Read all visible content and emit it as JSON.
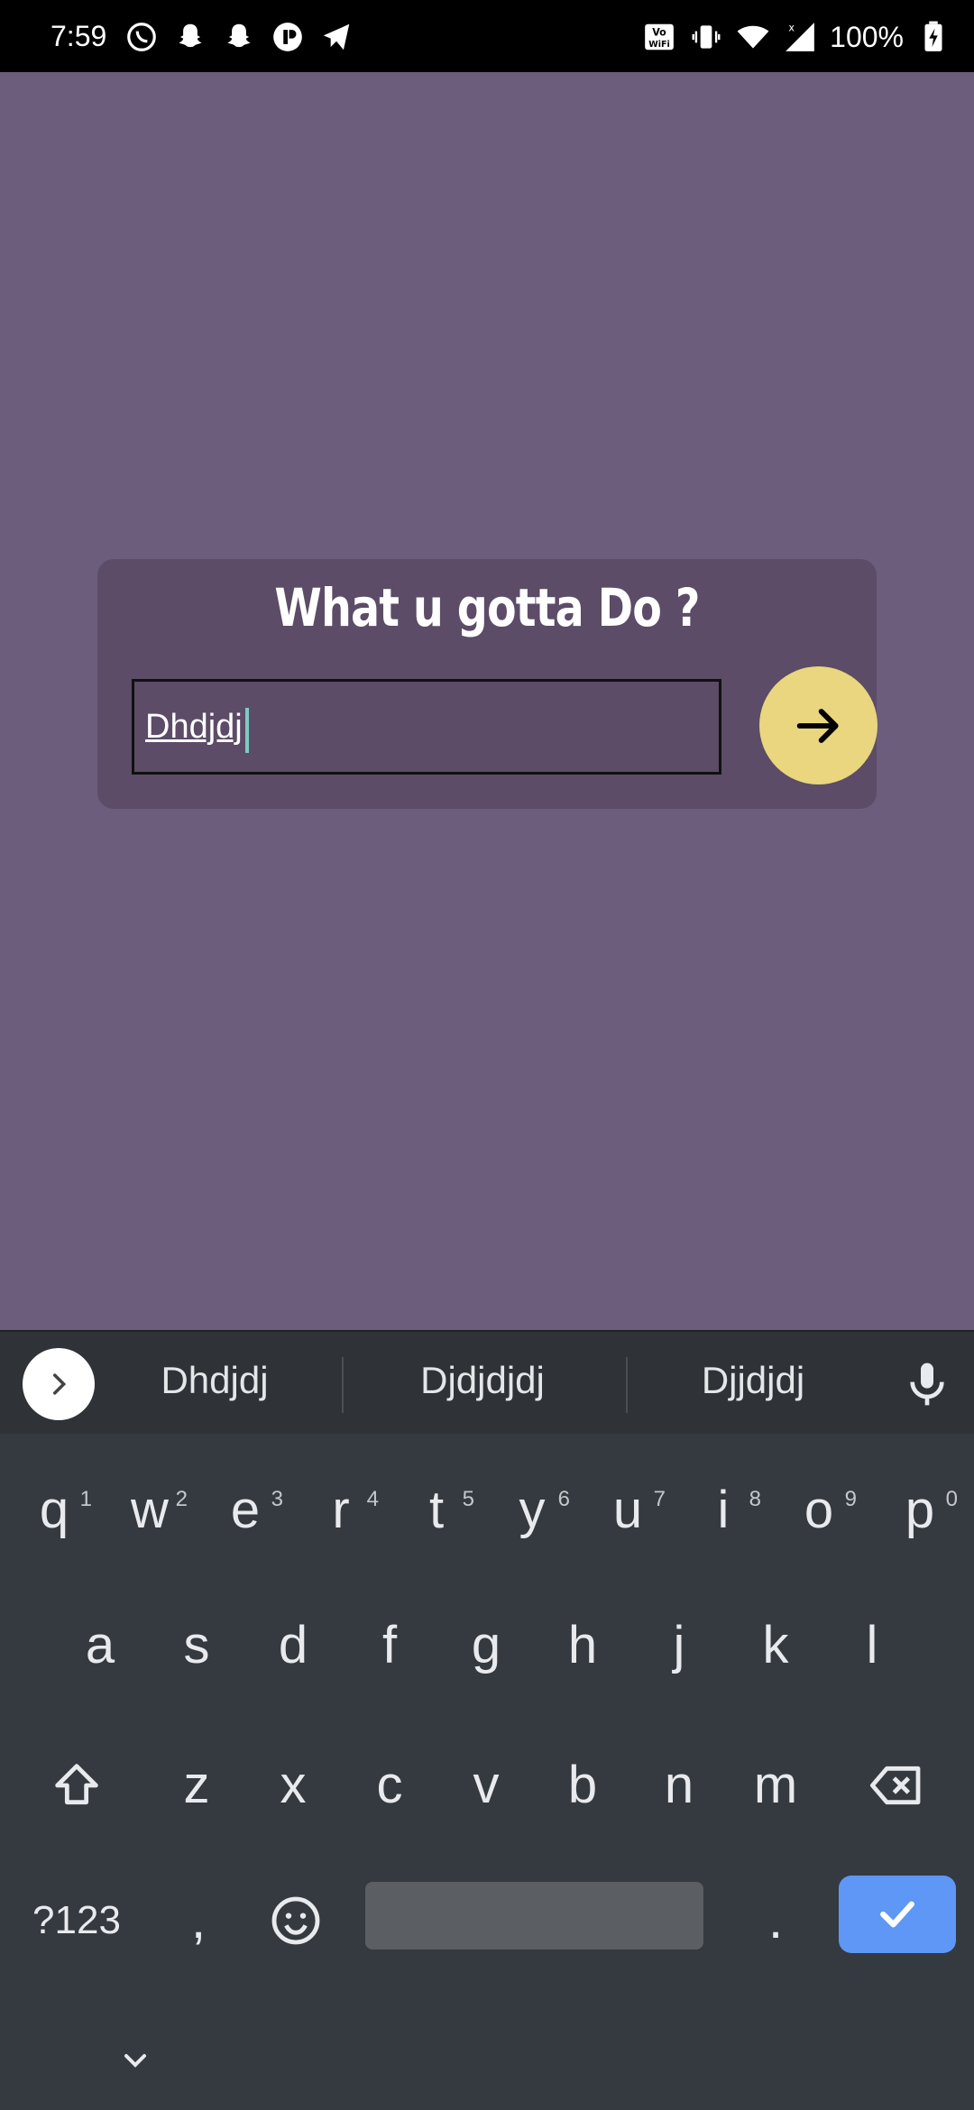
{
  "status": {
    "time": "7:59",
    "battery": "100%",
    "left_icons": [
      "whatsapp-icon",
      "snapchat-icon",
      "snapchat-icon",
      "app-icon",
      "telegram-icon"
    ],
    "right_icons": [
      "vowifi-icon",
      "vibrate-icon",
      "wifi-icon",
      "signal-icon",
      "battery-charging-icon"
    ]
  },
  "app": {
    "title": "What u gotta Do ?",
    "input_value": "Dhdjdj",
    "submit_icon": "arrow-right-icon",
    "colors": {
      "background": "#6b5d7b",
      "card": "#5c4c67",
      "button": "#e9d67e"
    }
  },
  "keyboard": {
    "suggestions": [
      "Dhdjdj",
      "Djdjdjdj",
      "Djjdjdj"
    ],
    "row1": [
      {
        "key": "q",
        "hint": "1"
      },
      {
        "key": "w",
        "hint": "2"
      },
      {
        "key": "e",
        "hint": "3"
      },
      {
        "key": "r",
        "hint": "4"
      },
      {
        "key": "t",
        "hint": "5"
      },
      {
        "key": "y",
        "hint": "6"
      },
      {
        "key": "u",
        "hint": "7"
      },
      {
        "key": "i",
        "hint": "8"
      },
      {
        "key": "o",
        "hint": "9"
      },
      {
        "key": "p",
        "hint": "0"
      }
    ],
    "row2": [
      "a",
      "s",
      "d",
      "f",
      "g",
      "h",
      "j",
      "k",
      "l"
    ],
    "row3": [
      "z",
      "x",
      "c",
      "v",
      "b",
      "n",
      "m"
    ],
    "symbols_label": "?123",
    "comma": ",",
    "period": ".",
    "accent_color": "#5e97f6"
  }
}
